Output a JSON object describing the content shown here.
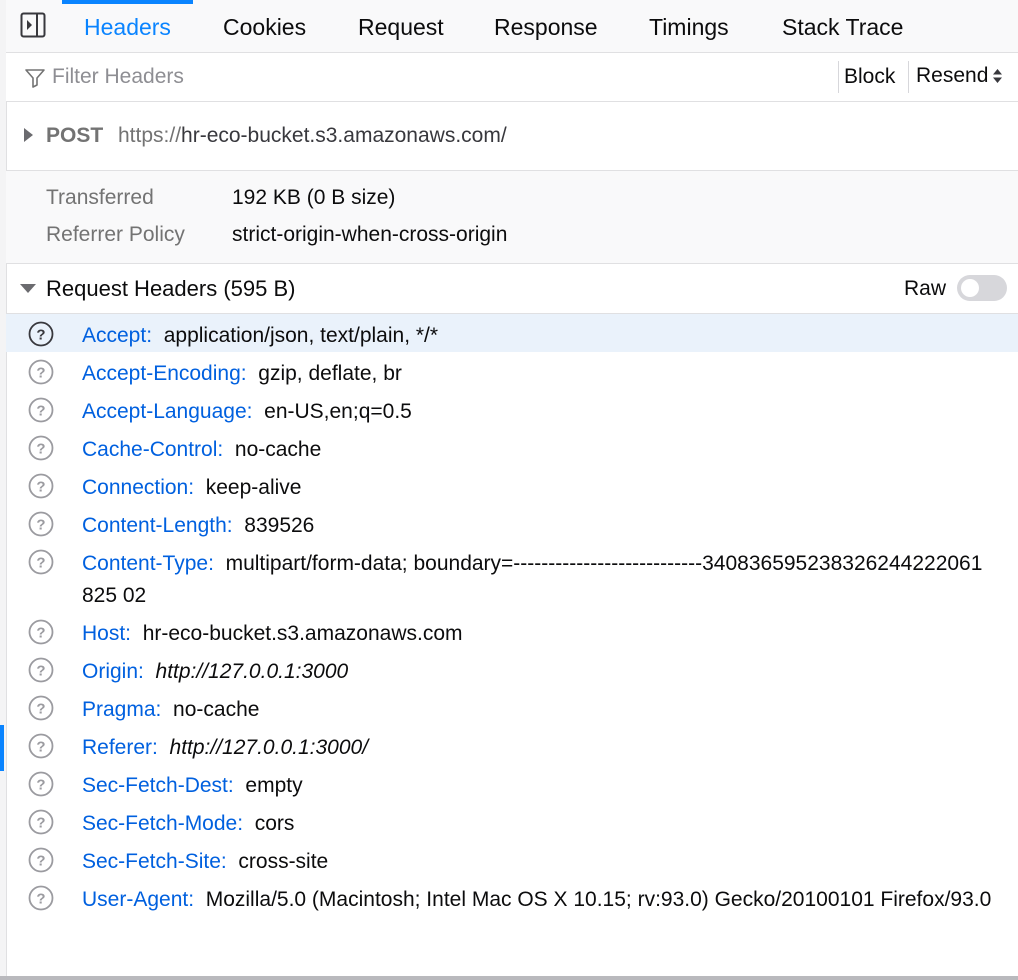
{
  "tabs": [
    {
      "label": "Headers",
      "active": true
    },
    {
      "label": "Cookies"
    },
    {
      "label": "Request"
    },
    {
      "label": "Response"
    },
    {
      "label": "Timings"
    },
    {
      "label": "Stack Trace"
    }
  ],
  "filter": {
    "placeholder": "Filter Headers",
    "value": "",
    "block_label": "Block",
    "resend_label": "Resend",
    "resend_arrows": "▲▼"
  },
  "summary": {
    "method": "POST",
    "scheme": "https://",
    "host_path": "hr-eco-bucket.s3.amazonaws.com/"
  },
  "meta": {
    "transferred_label": "Transferred",
    "transferred_value": "192 KB (0 B size)",
    "referrer_label": "Referrer Policy",
    "referrer_value": "strict-origin-when-cross-origin"
  },
  "request_headers": {
    "title": "Request Headers (595 B)",
    "raw_label": "Raw",
    "raw_enabled": false,
    "items": [
      {
        "name": "Accept:",
        "value": "application/json, text/plain, */*"
      },
      {
        "name": "Accept-Encoding:",
        "value": "gzip, deflate, br"
      },
      {
        "name": "Accept-Language:",
        "value": "en-US,en;q=0.5"
      },
      {
        "name": "Cache-Control:",
        "value": "no-cache"
      },
      {
        "name": "Connection:",
        "value": "keep-alive"
      },
      {
        "name": "Content-Length:",
        "value": "839526"
      },
      {
        "name": "Content-Type:",
        "value": "multipart/form-data; boundary=---------------------------340836595238326244222061825 02"
      },
      {
        "name": "Host:",
        "value": "hr-eco-bucket.s3.amazonaws.com"
      },
      {
        "name": "Origin:",
        "value": "http://127.0.0.1:3000"
      },
      {
        "name": "Pragma:",
        "value": "no-cache"
      },
      {
        "name": "Referer:",
        "value": "http://127.0.0.1:3000/"
      },
      {
        "name": "Sec-Fetch-Dest:",
        "value": "empty"
      },
      {
        "name": "Sec-Fetch-Mode:",
        "value": "cors"
      },
      {
        "name": "Sec-Fetch-Site:",
        "value": "cross-site"
      },
      {
        "name": "User-Agent:",
        "value": "Mozilla/5.0 (Macintosh; Intel Mac OS X 10.15; rv:93.0) Gecko/20100101 Firefox/93.0"
      }
    ]
  },
  "colors": {
    "accent": "#0a84ff",
    "header_name": "#0060df",
    "highlight_row": "#eaf2fb"
  },
  "icons": {
    "sidebar": "sidebar-toggle-icon",
    "filter": "filter-icon",
    "help": "help-circle-icon",
    "disclosure": "triangle-icon"
  }
}
